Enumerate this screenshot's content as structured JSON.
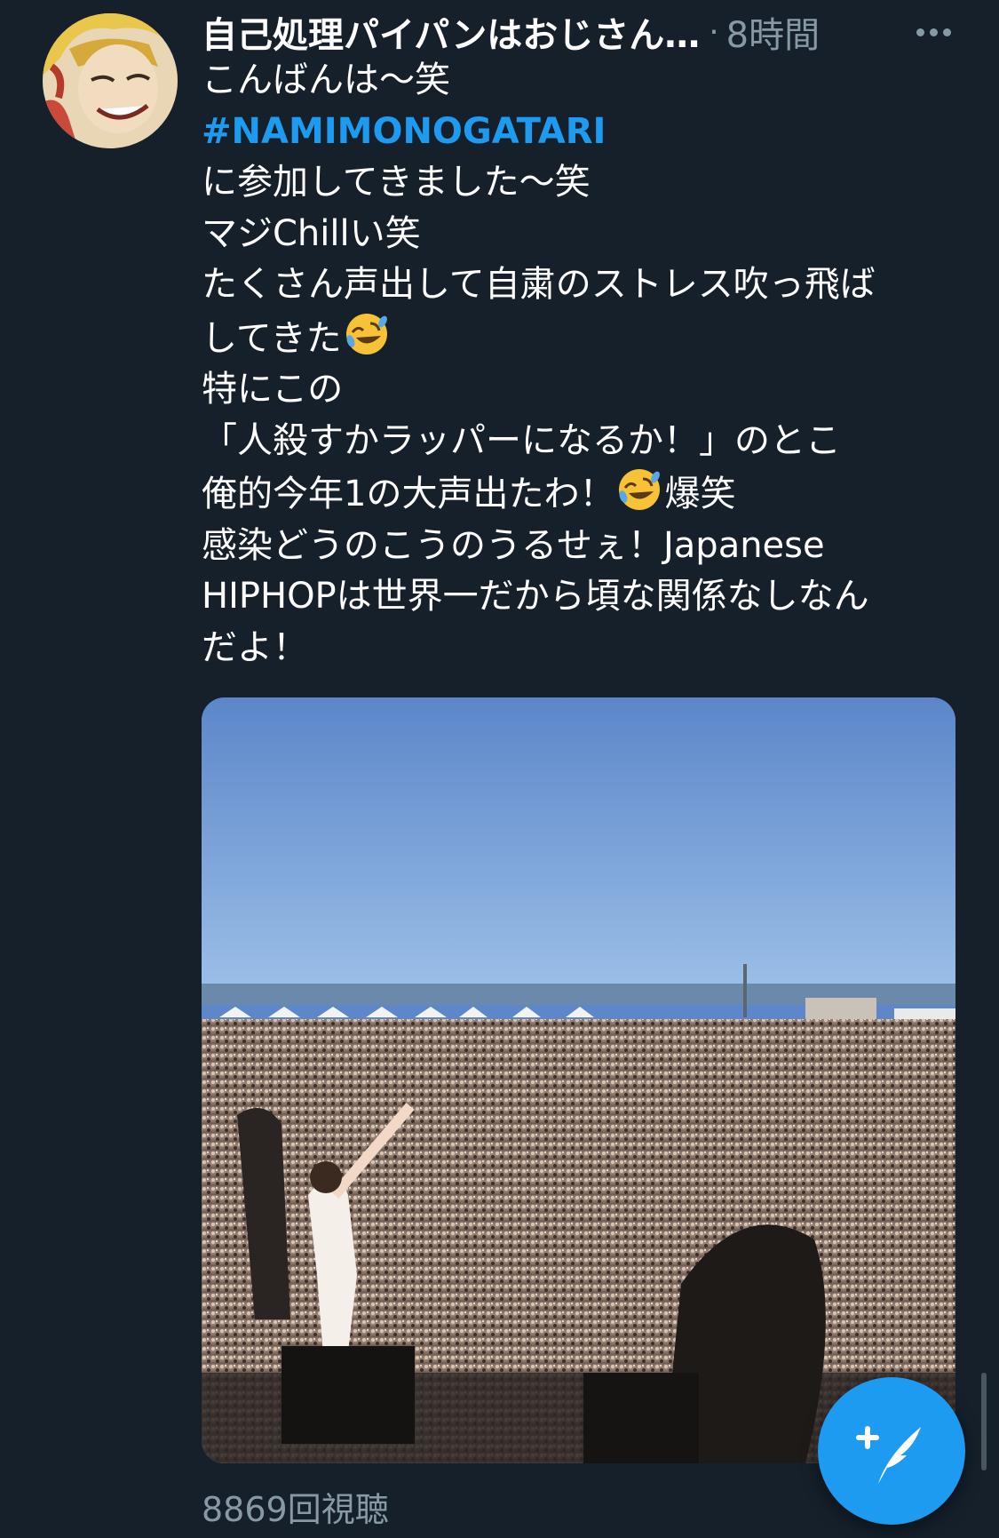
{
  "tweet": {
    "display_name": "自己処理パイパンはおじさん…",
    "separator": "·",
    "time": "8時間",
    "lines": {
      "l1": "こんばんは〜笑",
      "l2_hashtag": "#NAMIMONOGATARI",
      "l3": "に参加してきました〜笑",
      "l4": "マジChillい笑",
      "l5": "たくさん声出して自粛のストレス吹っ飛ば",
      "l6a": "してきた",
      "l7": "特にこの",
      "l8": "「人殺すかラッパーになるか！」のとこ",
      "l9a": "俺的今年1の大声出たわ！",
      "l9b": "爆笑",
      "l10": "感染どうのこうのうるせぇ！Japanese",
      "l11": "HIPHOPは世界一だから頃な関係なしなん",
      "l12": "だよ！"
    },
    "emoji_name": "rolling-on-the-floor-laughing",
    "view_count": "8869回視聴"
  },
  "icons": {
    "more": "more-dots-icon",
    "compose": "compose-tweet-icon"
  },
  "colors": {
    "background": "#15202b",
    "accent": "#1d9bf0",
    "secondary_text": "#8899a6"
  }
}
